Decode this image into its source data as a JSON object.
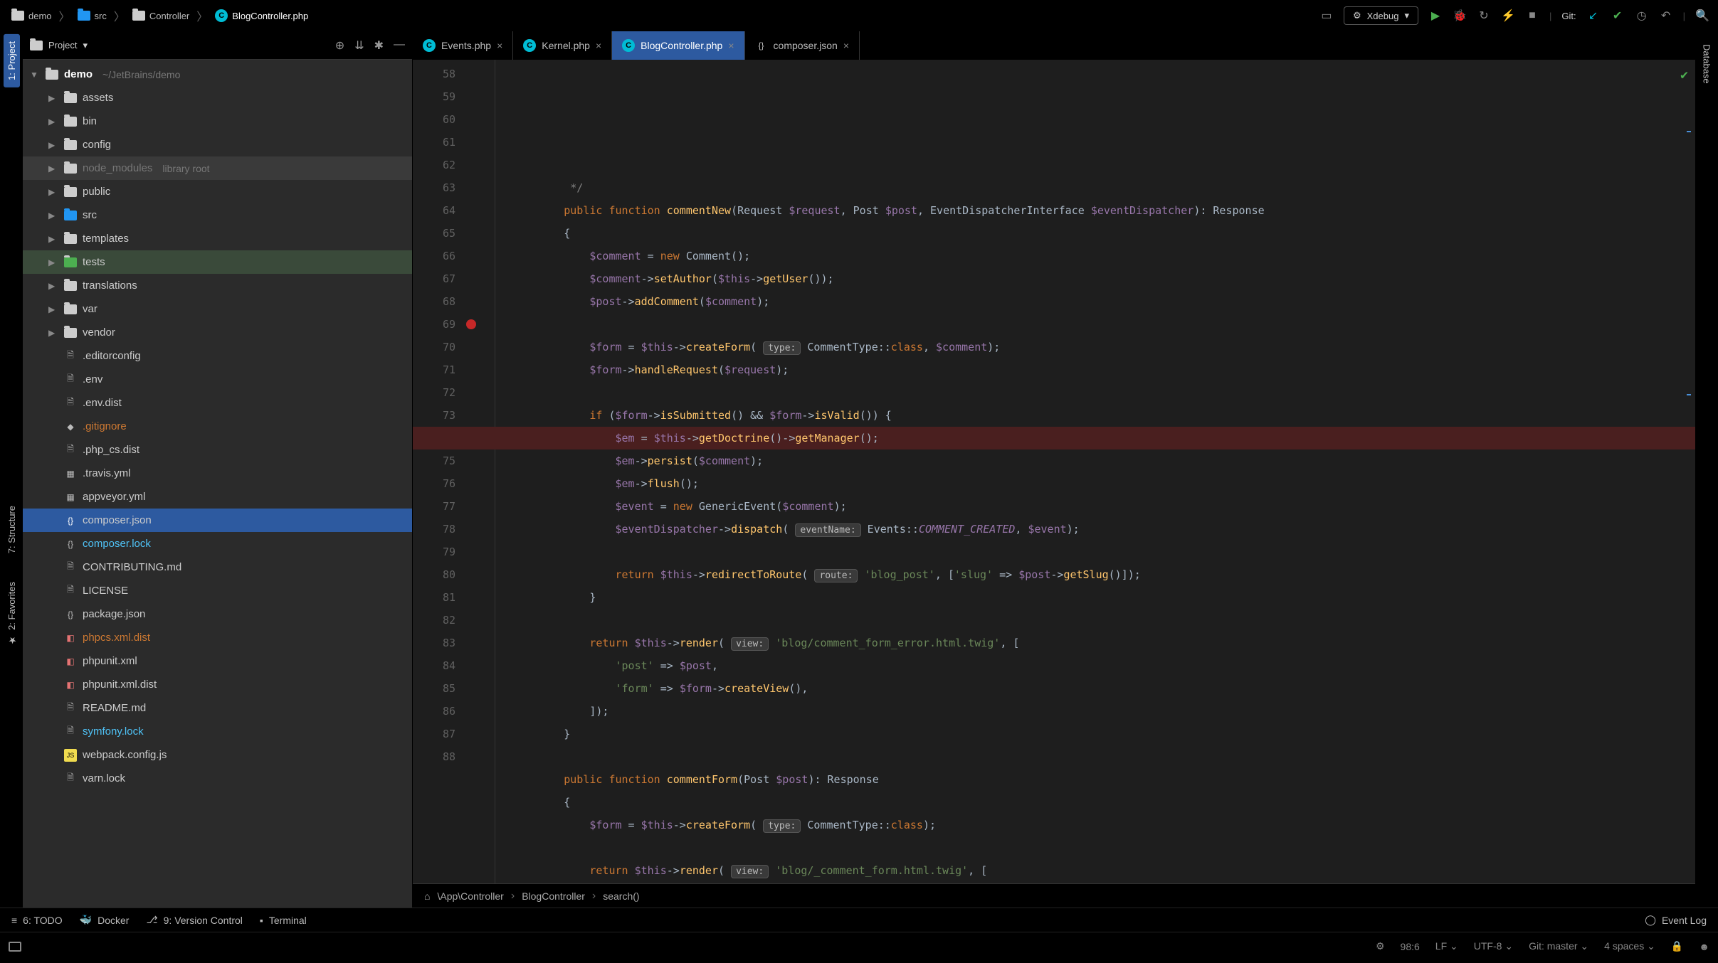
{
  "breadcrumbs": [
    {
      "icon": "folder",
      "label": "demo"
    },
    {
      "icon": "folder-blue",
      "label": "src"
    },
    {
      "icon": "folder",
      "label": "Controller"
    },
    {
      "icon": "php",
      "label": "BlogController.php",
      "active": true
    }
  ],
  "topbar": {
    "xdebug": "Xdebug",
    "git": "Git:"
  },
  "project_header": {
    "title": "Project"
  },
  "tree": [
    {
      "d": 0,
      "tw": "▼",
      "ico": "folder",
      "label": "demo",
      "bold": true,
      "suffix": "~/JetBrains/demo"
    },
    {
      "d": 1,
      "tw": "▶",
      "ico": "folder",
      "label": "assets"
    },
    {
      "d": 1,
      "tw": "▶",
      "ico": "folder",
      "label": "bin"
    },
    {
      "d": 1,
      "tw": "▶",
      "ico": "folder",
      "label": "config"
    },
    {
      "d": 1,
      "tw": "▶",
      "ico": "folder",
      "label": "node_modules",
      "grey": true,
      "suffix": "library root",
      "dim": true
    },
    {
      "d": 1,
      "tw": "▶",
      "ico": "folder",
      "label": "public"
    },
    {
      "d": 1,
      "tw": "▶",
      "ico": "folder-blue",
      "label": "src"
    },
    {
      "d": 1,
      "tw": "▶",
      "ico": "folder",
      "label": "templates"
    },
    {
      "d": 1,
      "tw": "▶",
      "ico": "folder-green",
      "label": "tests",
      "hl": true
    },
    {
      "d": 1,
      "tw": "▶",
      "ico": "folder",
      "label": "translations"
    },
    {
      "d": 1,
      "tw": "▶",
      "ico": "folder",
      "label": "var"
    },
    {
      "d": 1,
      "tw": "▶",
      "ico": "folder",
      "label": "vendor"
    },
    {
      "d": 1,
      "tw": "",
      "ico": "file",
      "label": ".editorconfig"
    },
    {
      "d": 1,
      "tw": "",
      "ico": "file",
      "label": ".env"
    },
    {
      "d": 1,
      "tw": "",
      "ico": "file",
      "label": ".env.dist"
    },
    {
      "d": 1,
      "tw": "",
      "ico": "diamond",
      "label": ".gitignore",
      "orange": true
    },
    {
      "d": 1,
      "tw": "",
      "ico": "file",
      "label": ".php_cs.dist"
    },
    {
      "d": 1,
      "tw": "",
      "ico": "grid",
      "label": ".travis.yml"
    },
    {
      "d": 1,
      "tw": "",
      "ico": "grid",
      "label": "appveyor.yml"
    },
    {
      "d": 1,
      "tw": "",
      "ico": "json",
      "label": "composer.json",
      "sel": true
    },
    {
      "d": 1,
      "tw": "",
      "ico": "json",
      "label": "composer.lock",
      "cyan": true
    },
    {
      "d": 1,
      "tw": "",
      "ico": "file",
      "label": "CONTRIBUTING.md"
    },
    {
      "d": 1,
      "tw": "",
      "ico": "file",
      "label": "LICENSE"
    },
    {
      "d": 1,
      "tw": "",
      "ico": "json",
      "label": "package.json"
    },
    {
      "d": 1,
      "tw": "",
      "ico": "xml",
      "label": "phpcs.xml.dist",
      "orange": true
    },
    {
      "d": 1,
      "tw": "",
      "ico": "xml",
      "label": "phpunit.xml"
    },
    {
      "d": 1,
      "tw": "",
      "ico": "xml",
      "label": "phpunit.xml.dist"
    },
    {
      "d": 1,
      "tw": "",
      "ico": "file",
      "label": "README.md"
    },
    {
      "d": 1,
      "tw": "",
      "ico": "file",
      "label": "symfony.lock",
      "cyan": true
    },
    {
      "d": 1,
      "tw": "",
      "ico": "js",
      "label": "webpack.config.js"
    },
    {
      "d": 1,
      "tw": "",
      "ico": "file",
      "label": "varn.lock"
    }
  ],
  "tabs": [
    {
      "icon": "php",
      "label": "Events.php"
    },
    {
      "icon": "php",
      "label": "Kernel.php"
    },
    {
      "icon": "php",
      "label": "BlogController.php",
      "active": true
    },
    {
      "icon": "json",
      "label": "composer.json"
    }
  ],
  "code": {
    "start": 58,
    "lines": [
      {
        "html": "         <span class='cmt'>*/</span>"
      },
      {
        "html": "        <span class='kw'>public function</span> <span class='fn'>commentNew</span>(Request <span class='var'>$request</span>, Post <span class='var'>$post</span>, EventDispatcherInterface <span class='var'>$eventDispatcher</span>): Response"
      },
      {
        "html": "        {"
      },
      {
        "html": "            <span class='var'>$comment</span> = <span class='kw'>new</span> Comment();"
      },
      {
        "html": "            <span class='var'>$comment</span>-><span class='fn'>setAuthor</span>(<span class='var'>$this</span>-><span class='fn'>getUser</span>());"
      },
      {
        "html": "            <span class='var'>$post</span>-><span class='fn'>addComment</span>(<span class='var'>$comment</span>);"
      },
      {
        "html": ""
      },
      {
        "html": "            <span class='var'>$form</span> = <span class='var'>$this</span>-><span class='fn'>createForm</span>( <span class='hint'>type:</span> CommentType::<span class='kw'>class</span>, <span class='var'>$comment</span>);"
      },
      {
        "html": "            <span class='var'>$form</span>-><span class='fn'>handleRequest</span>(<span class='var'>$request</span>);"
      },
      {
        "html": ""
      },
      {
        "html": "            <span class='kw'>if</span> (<span class='var'>$form</span>-><span class='fn'>isSubmitted</span>() && <span class='var'>$form</span>-><span class='fn'>isValid</span>()) {"
      },
      {
        "bp": true,
        "html": "                <span class='var'>$em</span> = <span class='var'>$this</span>-><span class='fn'>getDoctrine</span>()-><span class='fn'>getManager</span>();"
      },
      {
        "html": "                <span class='var'>$em</span>-><span class='fn'>persist</span>(<span class='var'>$comment</span>);"
      },
      {
        "html": "                <span class='var'>$em</span>-><span class='fn'>flush</span>();"
      },
      {
        "html": "                <span class='var'>$event</span> = <span class='kw'>new</span> GenericEvent(<span class='var'>$comment</span>);"
      },
      {
        "html": "                <span class='var'>$eventDispatcher</span>-><span class='fn'>dispatch</span>( <span class='hint'>eventName:</span> Events::<span class='const'>COMMENT_CREATED</span>, <span class='var'>$event</span>);"
      },
      {
        "html": ""
      },
      {
        "html": "                <span class='kw'>return</span> <span class='var'>$this</span>-><span class='fn'>redirectToRoute</span>( <span class='hint'>route:</span> <span class='str'>'blog_post'</span>, [<span class='str'>'slug'</span> => <span class='var'>$post</span>-><span class='fn'>getSlug</span>()]);"
      },
      {
        "html": "            }"
      },
      {
        "html": ""
      },
      {
        "html": "            <span class='kw'>return</span> <span class='var'>$this</span>-><span class='fn'>render</span>( <span class='hint'>view:</span> <span class='str'>'blog/comment_form_error.html.twig'</span>, ["
      },
      {
        "html": "                <span class='str'>'post'</span> => <span class='var'>$post</span>,"
      },
      {
        "html": "                <span class='str'>'form'</span> => <span class='var'>$form</span>-><span class='fn'>createView</span>(),"
      },
      {
        "html": "            ]);"
      },
      {
        "html": "        }"
      },
      {
        "html": ""
      },
      {
        "html": "        <span class='kw'>public function</span> <span class='fn'>commentForm</span>(Post <span class='var'>$post</span>): Response"
      },
      {
        "html": "        {"
      },
      {
        "html": "            <span class='var'>$form</span> = <span class='var'>$this</span>-><span class='fn'>createForm</span>( <span class='hint'>type:</span> CommentType::<span class='kw'>class</span>);"
      },
      {
        "html": ""
      },
      {
        "html": "            <span class='kw'>return</span> <span class='var'>$this</span>-><span class='fn'>render</span>( <span class='hint'>view:</span> <span class='str'>'blog/_comment_form.html.twig'</span>, ["
      }
    ]
  },
  "editor_crumb": [
    "\\App\\Controller",
    "BlogController",
    "search()"
  ],
  "bottom_tools": {
    "todo": "6: TODO",
    "docker": "Docker",
    "vc": "9: Version Control",
    "terminal": "Terminal",
    "event_log": "Event Log"
  },
  "status": {
    "pos": "98:6",
    "le": "LF",
    "enc": "UTF-8",
    "git": "Git: master",
    "indent": "4 spaces"
  },
  "left_tabs": {
    "project": "1: Project",
    "structure": "7: Structure",
    "favorites": "2: Favorites"
  },
  "right_tabs": {
    "database": "Database"
  }
}
